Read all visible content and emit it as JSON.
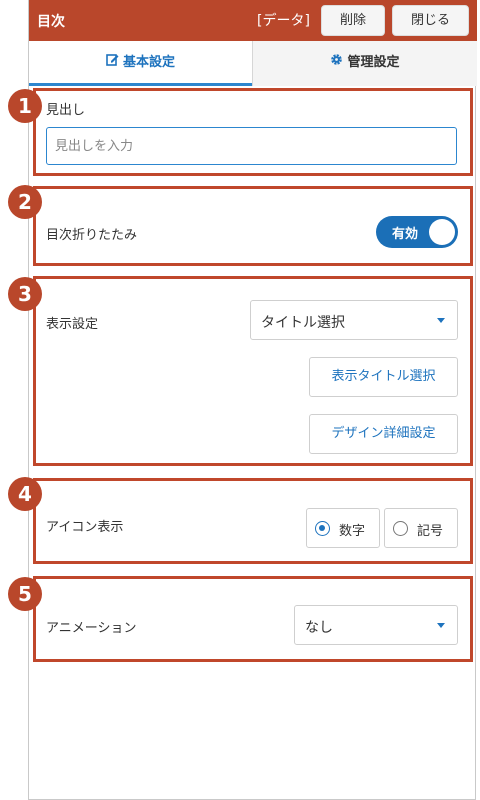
{
  "header": {
    "title": "目次",
    "context": "[データ]",
    "delete_label": "削除",
    "close_label": "閉じる",
    "accent_color": "#b9472b"
  },
  "tabs": [
    {
      "label": "基本設定",
      "icon": "edit-icon",
      "active": true
    },
    {
      "label": "管理設定",
      "icon": "gear-icon",
      "active": false
    }
  ],
  "sections": [
    {
      "number": "1",
      "label": "見出し",
      "input_placeholder": "見出しを入力",
      "input_value": ""
    },
    {
      "number": "2",
      "label": "目次折りたたみ",
      "toggle_label": "有効",
      "toggle_on": true
    },
    {
      "number": "3",
      "label": "表示設定",
      "select_value": "タイトル選択",
      "button1": "表示タイトル選択",
      "button2": "デザイン詳細設定"
    },
    {
      "number": "4",
      "label": "アイコン表示",
      "options": [
        "数字",
        "記号"
      ],
      "selected": "数字"
    },
    {
      "number": "5",
      "label": "アニメーション",
      "select_value": "なし"
    }
  ]
}
